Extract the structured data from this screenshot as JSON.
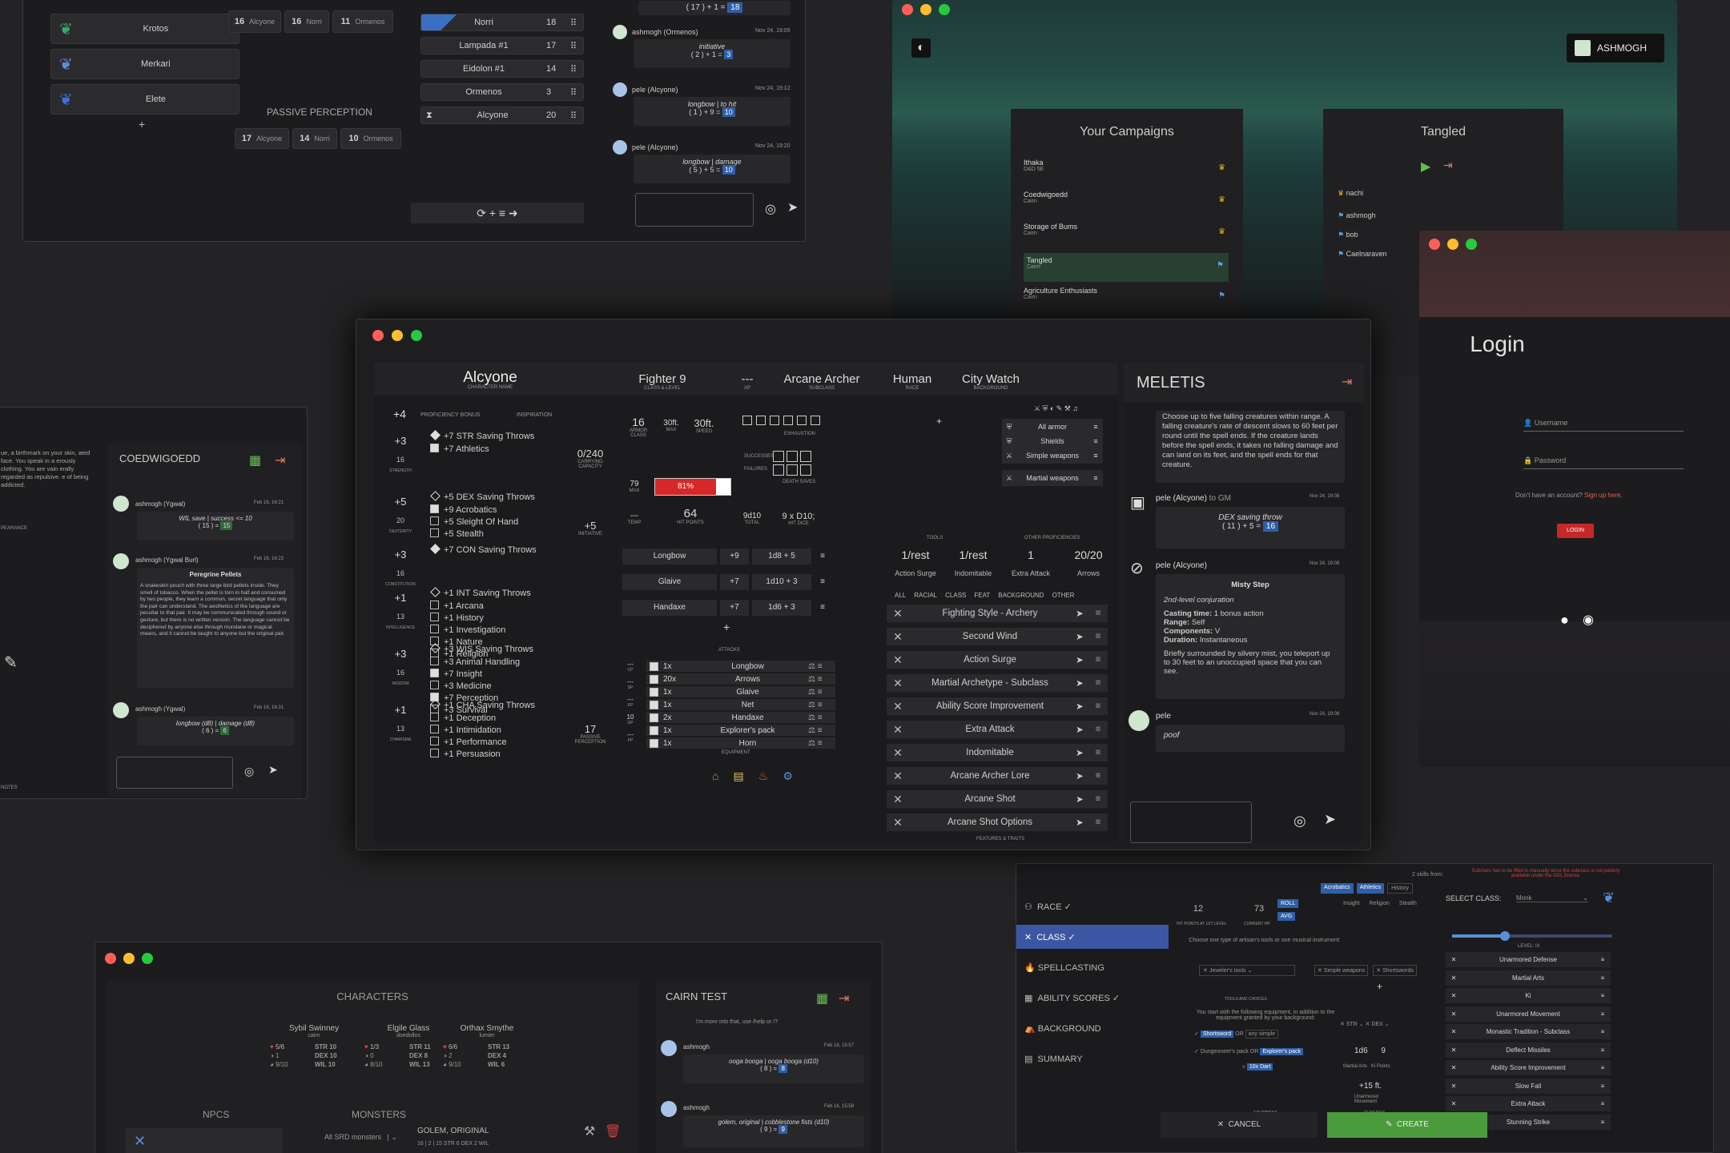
{
  "colors": {
    "bg": "#232325",
    "panel": "#1d1d1f",
    "accent_blue": "#2f5fa8",
    "hp_red": "#d62828",
    "create_green": "#4a9b3c",
    "login_red": "#c62828",
    "gold": "#e0b030"
  },
  "top_left": {
    "npc_list": [
      "Krotos",
      "Merkari",
      "Elete"
    ],
    "add": "+",
    "scores_top": [
      {
        "v": "16",
        "n": "Alcyone"
      },
      {
        "v": "16",
        "n": "Norri"
      },
      {
        "v": "11",
        "n": "Ormenos"
      }
    ],
    "passive_title": "PASSIVE PERCEPTION",
    "scores_bottom": [
      {
        "v": "17",
        "n": "Alcyone"
      },
      {
        "v": "14",
        "n": "Norri"
      },
      {
        "v": "10",
        "n": "Ormenos"
      }
    ],
    "initiative": [
      {
        "n": "Norri",
        "v": "18"
      },
      {
        "n": "Lampada #1",
        "v": "17"
      },
      {
        "n": "Eidolon #1",
        "v": "14"
      },
      {
        "n": "Ormenos",
        "v": "3"
      },
      {
        "n": "Alcyone",
        "v": "20"
      }
    ],
    "controls": "⟳ + ≡ ➜"
  },
  "top_chat": {
    "roll0": "( 17 ) + 1 = ",
    "roll0v": "18",
    "m1": {
      "who": "ashmogh (Ormenos)",
      "time": "Nov 24, 19:05",
      "lbl": "initiative",
      "roll": "( 2 ) + 1 = ",
      "v": "3"
    },
    "m2": {
      "who": "pele (Alcyone)",
      "time": "Nov 24, 19:12",
      "lbl": "longbow | to hit",
      "roll": "( 1 ) + 9 = ",
      "v": "10"
    },
    "m3": {
      "who": "pele (Alcyone)",
      "time": "Nov 24, 19:20",
      "lbl": "longbow | damage",
      "roll": "( 5 ) + 5 = ",
      "v": "10"
    }
  },
  "campaign": {
    "user": "ASHMOGH",
    "title": "Your Campaigns",
    "list": [
      {
        "n": "Ithaka",
        "s": "D&D 5E"
      },
      {
        "n": "Coedwigoedd",
        "s": "Cairn"
      },
      {
        "n": "Storage of Bums",
        "s": "Cairn"
      },
      {
        "n": "Tangled",
        "s": "Cairn"
      },
      {
        "n": "Agriculture Enthusiasts",
        "s": "Cairn"
      }
    ],
    "tangled_title": "Tangled",
    "members": [
      "nachi",
      "ashmogh",
      "bob",
      "Caelnaraven"
    ]
  },
  "login": {
    "title": "Login",
    "user_ph": "Username",
    "pass_ph": "Password",
    "signup": "Don't have an account?",
    "signup_link": "Sign up here.",
    "btn": "LOGIN"
  },
  "left_chat": {
    "title": "COEDWIGOEDD",
    "frag": "ue, a birthmark on your skin, ated face. You speak in a erously clothing. You are vain erally regarded as repulsive. e of being addicted.",
    "frag_label": "PEARANCE",
    "notes": "NOTES",
    "m1": {
      "who": "ashmogh (Ygwal)",
      "time": "Feb 16, 16:21",
      "lbl": "WIL save | success <= 10",
      "roll": "( 15 ) = ",
      "v": "15"
    },
    "m2": {
      "who": "ashmogh (Ygwal Burl)",
      "time": "Feb 16, 16:23",
      "title": "Peregrine Pellets",
      "body": "A snakeskin pouch with three large bird pellets inside. They smell of tobacco. When the pellet is torn in half and consumed by two people, they learn a common, secret language that only the pair can understand. The aesthetics of the language are peculiar to that pair. It may be communicated through sound or gesture, but there is no written version. The language cannot be deciphered by anyone else through mundane or magical means, and it cannot be taught to anyone but the original pair."
    },
    "m3": {
      "who": "ashmogh (Ygwal)",
      "time": "Feb 16, 16:31",
      "lbl": "longbow (d8) | damage (d8)",
      "roll": "( 6 ) = ",
      "v": "6"
    }
  },
  "sheet": {
    "name": "Alcyone",
    "name_l": "CHARACTER NAME",
    "class": "Fighter 9",
    "class_l": "CLASS & LEVEL",
    "xp": "---",
    "xp_l": "XP",
    "sub": "Arcane Archer",
    "sub_l": "SUBCLASS",
    "race": "Human",
    "race_l": "RACE",
    "bg": "City Watch",
    "bg_l": "BACKGROUND",
    "prof": "+4",
    "prof_l": "PROFICIENCY BONUS",
    "insp_l": "INSPIRATION",
    "abilities": [
      {
        "mod": "+3",
        "score": "16",
        "name": "STRENGTH",
        "skills": [
          {
            "d": true,
            "t": "+7 STR Saving Throws"
          },
          {
            "c": true,
            "t": "+7 Athletics"
          }
        ]
      },
      {
        "mod": "+5",
        "score": "20",
        "name": "DEXTERITY",
        "skills": [
          {
            "d": false,
            "t": "+5 DEX Saving Throws"
          },
          {
            "c": true,
            "t": "+9 Acrobatics"
          },
          {
            "c": false,
            "t": "+5 Sleight Of Hand"
          },
          {
            "c": false,
            "t": "+5 Stealth"
          }
        ]
      },
      {
        "mod": "+3",
        "score": "16",
        "name": "CONSTITUTION",
        "skills": [
          {
            "d": true,
            "t": "+7 CON Saving Throws"
          }
        ]
      },
      {
        "mod": "+1",
        "score": "13",
        "name": "INTELLIGENCE",
        "skills": [
          {
            "d": false,
            "t": "+1 INT Saving Throws"
          },
          {
            "c": false,
            "t": "+1 Arcana"
          },
          {
            "c": false,
            "t": "+1 History"
          },
          {
            "c": false,
            "t": "+1 Investigation"
          },
          {
            "c": false,
            "t": "+1 Nature"
          },
          {
            "c": false,
            "t": "+1 Religion"
          }
        ]
      },
      {
        "mod": "+3",
        "score": "16",
        "name": "WISDOM",
        "skills": [
          {
            "d": false,
            "t": "+3 WIS Saving Throws"
          },
          {
            "c": false,
            "t": "+3 Animal Handling"
          },
          {
            "c": true,
            "t": "+7 Insight"
          },
          {
            "c": false,
            "t": "+3 Medicine"
          },
          {
            "c": true,
            "t": "+7 Perception"
          },
          {
            "c": false,
            "t": "+3 Survival"
          }
        ]
      },
      {
        "mod": "+1",
        "score": "13",
        "name": "CHARISMA",
        "skills": [
          {
            "d": false,
            "t": "+1 CHA Saving Throws"
          },
          {
            "c": false,
            "t": "+1 Deception"
          },
          {
            "c": false,
            "t": "+1 Intimidation"
          },
          {
            "c": false,
            "t": "+1 Performance"
          },
          {
            "c": false,
            "t": "+1 Persuasion"
          }
        ]
      }
    ],
    "carry": "0/240",
    "carry_l": "CARRYING CAPACITY",
    "init": "+5",
    "init_l": "INITIATIVE",
    "passive": "17",
    "passive_l": "PASSIVE PERCEPTION",
    "ac": "16",
    "ac_l": "ARMOR CLASS",
    "spd_max": "30ft.",
    "spd_max_l": "MAX",
    "spd": "30ft.",
    "spd_l": "SPEED",
    "hp_max": "79",
    "hp_max_l": "MAX",
    "hp_pct": "81%",
    "hp_fill": 0.81,
    "hp": "64",
    "hp_l": "HIT POINTS",
    "temp": "---",
    "temp_l": "TEMP",
    "hd_total": "9d10",
    "hd_total_l": "TOTAL",
    "hd": "9 x D10;",
    "hd_l": "HIT DICE",
    "exh_l": "EXHAUSTION",
    "succ_l": "SUCCESSES",
    "fail_l": "FAILURES",
    "ds_l": "DEATH SAVES",
    "weapons": [
      {
        "n": "Longbow",
        "h": "+9",
        "d": "1d8 + 5"
      },
      {
        "n": "Glaive",
        "h": "+7",
        "d": "1d10 + 3"
      },
      {
        "n": "Handaxe",
        "h": "+7",
        "d": "1d6 + 3"
      }
    ],
    "attacks_l": "ATTACKS",
    "add": "+",
    "equip": [
      {
        "q": "1x",
        "n": "Longbow"
      },
      {
        "q": "20x",
        "n": "Arrows"
      },
      {
        "q": "1x",
        "n": "Glaive"
      },
      {
        "q": "1x",
        "n": "Net"
      },
      {
        "q": "2x",
        "n": "Handaxe"
      },
      {
        "q": "1x",
        "n": "Explorer's pack"
      },
      {
        "q": "1x",
        "n": "Horn"
      }
    ],
    "coins": [
      "CP",
      "SP",
      "EP",
      "GP",
      "PP"
    ],
    "coin_v": [
      "---",
      "---",
      "---",
      "10",
      "---"
    ],
    "equip_l": "EQUIPMENT",
    "tools_l": "TOOLS",
    "prof_l2": "OTHER PROFICIENCIES",
    "profs": [
      "All armor",
      "Shields",
      "Simple weapons",
      "Martial weapons"
    ],
    "res": [
      {
        "v": "1/rest",
        "n": "Action Surge"
      },
      {
        "v": "1/rest",
        "n": "Indomitable"
      },
      {
        "v": "1",
        "n": "Extra Attack"
      },
      {
        "v": "20/20",
        "n": "Arrows"
      }
    ],
    "filters": [
      "ALL",
      "RACIAL",
      "CLASS",
      "FEAT",
      "BACKGROUND",
      "OTHER"
    ],
    "features": [
      "Fighting Style - Archery",
      "Second Wind",
      "Action Surge",
      "Martial Archetype - Subclass",
      "Ability Score Improvement",
      "Extra Attack",
      "Indomitable",
      "Arcane Archer Lore",
      "Arcane Shot",
      "Arcane Shot Options"
    ],
    "feat_l": "FEATURES & TRAITS"
  },
  "meletis": {
    "title": "MELETIS",
    "spell_text": "Choose up to five falling creatures within range. A falling creature's rate of descent slows to 60 feet per round until the spell ends. If the creature lands before the spell ends, it takes no falling damage and can land on its feet, and the spell ends for that creature.",
    "m1": {
      "who": "pele (Alcyone)",
      "to": "to GM",
      "time": "Nov 24, 19:08",
      "lbl": "DEX saving throw",
      "roll": "( 11 ) + 5 = ",
      "v": "16"
    },
    "m2": {
      "who": "pele (Alcyone)",
      "time": "Nov 24, 19:08",
      "title": "Misty Step",
      "lvl": "2nd-level conjuration",
      "ct_l": "Casting time:",
      "ct": "1 bonus action",
      "rg_l": "Range:",
      "rg": "Self",
      "cp_l": "Components:",
      "cp": "V",
      "du_l": "Duration:",
      "du": "Instantaneous",
      "desc": "Briefly surrounded by silvery mist, you teleport up to 30 feet to an unoccupied space that you can see."
    },
    "m3": {
      "who": "pele",
      "time": "Nov 24, 19:08",
      "txt": "poof"
    }
  },
  "wizard": {
    "steps": [
      "RACE",
      "CLASS",
      "SPELLCASTING",
      "ABILITY SCORES",
      "BACKGROUND",
      "SUMMARY"
    ],
    "tool_txt": "Choose one type of artisan's tools or one musical instrument:",
    "tool_sel": "Jeweler's tools",
    "tool_l": "TOOLS AND CHOICES",
    "equip_txt": "You start with the following equipment, in addition to the equipment granted by your background:",
    "e1a": "Shortsword",
    "or": "OR",
    "e1b": "any simple",
    "e2a": "Dungeoneer's pack",
    "e2b": "Explorer's pack",
    "e3": "10x Dart",
    "equip_l": "EQUIPMENT",
    "hp": "12",
    "hp_l": "HIT POINTS AT 1ST LEVEL",
    "hpc": "73",
    "hpc_l": "CURRENT HP",
    "roll": "ROLL",
    "avg": "AVG",
    "skills_hdr": "2 skills from:",
    "sk_sel": [
      "Acrobatics",
      "Athletics"
    ],
    "sk_opts": [
      "History",
      "Insight",
      "Religion",
      "Stealth"
    ],
    "profs": [
      "Simple weapons",
      "Shortswords"
    ],
    "str": "STR",
    "dex": "DEX",
    "hd": "1d6",
    "hd_l": "Martial Arts",
    "ki": "9",
    "ki_l": "Ki Points",
    "mv": "+15 ft.",
    "mv_l": "Unarmored Movement",
    "feat_l": "FEATURES",
    "warn": "Subclass has to be filled in manually since the subclass is not publicly available under the OGL license.",
    "sel_l": "SELECT CLASS:",
    "sel": "Monk",
    "lvl_l": "LEVEL: IX",
    "features": [
      "Unarmored Defense",
      "Martial Arts",
      "Ki",
      "Unarmored Movement",
      "Monastic Tradition - Subclass",
      "Deflect Missiles",
      "Ability Score Improvement",
      "Slow Fall",
      "Extra Attack",
      "Stunning Strike"
    ],
    "cancel": "CANCEL",
    "create": "CREATE"
  },
  "cairn": {
    "chars_title": "CHARACTERS",
    "chars": [
      {
        "n": "Sybil Swinney",
        "s": "cairn",
        "hp": "5/6",
        "a": "1",
        "w": "9/10",
        "st": "STR 10",
        "dx": "DEX 10",
        "wl": "WIL 10"
      },
      {
        "n": "Elgile Glass",
        "s": "doedollos",
        "hp": "1/3",
        "a": "0",
        "w": "8/10",
        "st": "STR 11",
        "dx": "DEX 8",
        "wl": "WIL 13"
      },
      {
        "n": "Orthax Smythe",
        "s": "lumier",
        "hp": "6/6",
        "a": "2",
        "w": "9/10",
        "st": "STR 13",
        "dx": "DEX 4",
        "wl": "WIL 6"
      }
    ],
    "npcs": "NPCS",
    "monsters": "MONSTERS",
    "srd": "All SRD monsters",
    "golem": "GOLEM, ORIGINAL",
    "golem_stats": "16 | 2 | 15 STR 6 DEX 2 WIL",
    "title": "CAIRN TEST",
    "top_txt": "I'm more into that, use /help or /?",
    "m1": {
      "who": "ashmogh",
      "time": "Feb 16, 15:57",
      "lbl": "ooga booga | ooga booga (d10)",
      "roll": "( 8 ) = ",
      "v": "8"
    },
    "m2": {
      "who": "ashmogh",
      "time": "Feb 16, 15:58",
      "lbl": "golem, original | cobblestone fists (d10)",
      "roll": "( 9 ) = ",
      "v": "9"
    }
  }
}
